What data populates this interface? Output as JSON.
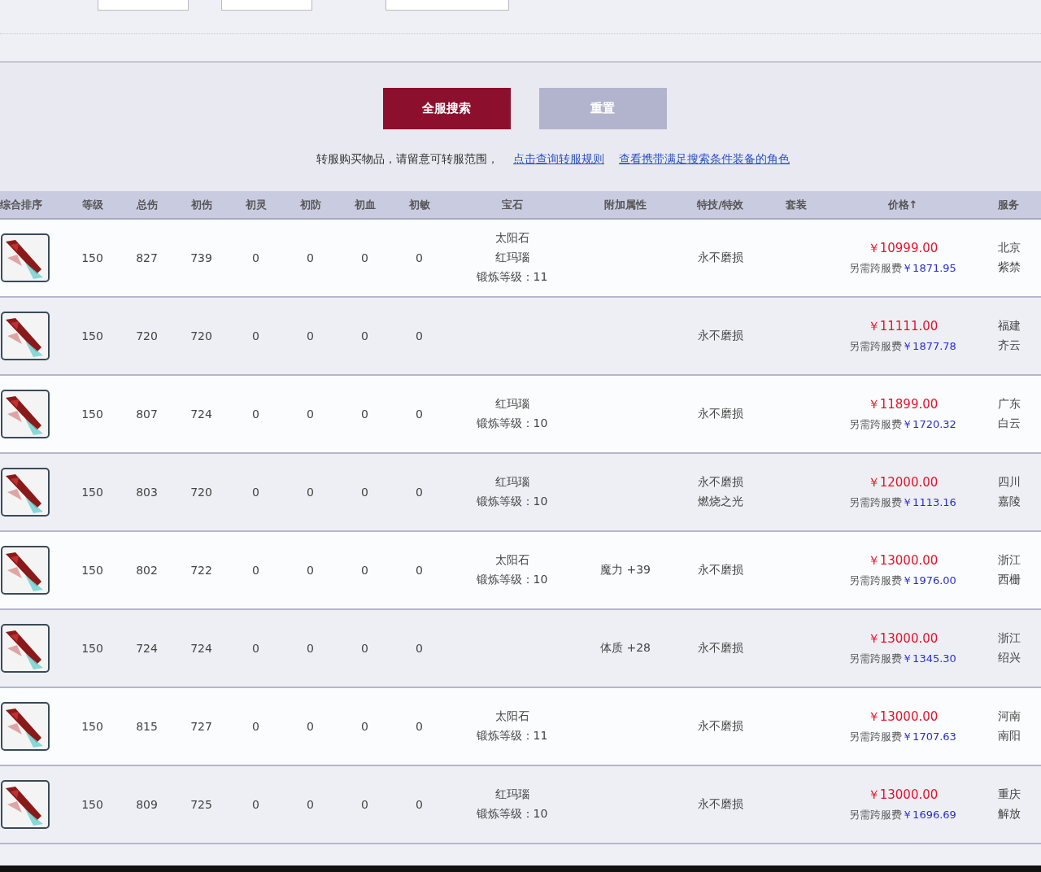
{
  "buttons": [
    {
      "label": "全服搜索",
      "kind": "primary"
    },
    {
      "label": "重置",
      "kind": "secondary"
    }
  ],
  "notice": {
    "text": "转服购买物品，请留意可转服范围，",
    "links": [
      "点击查询转服规则",
      "查看携带满足搜索条件装备的角色"
    ]
  },
  "table": {
    "columns": [
      "综合排序",
      "等级",
      "总伤",
      "初伤",
      "初灵",
      "初防",
      "初血",
      "初敏",
      "宝石",
      "附加属性",
      "特技/特效",
      "套装",
      "价格↑",
      "服务"
    ],
    "rows": [
      {
        "level": "150",
        "total": "827",
        "base": [
          "739",
          "0",
          "0",
          "0",
          "0"
        ],
        "gems": [
          "太阳石",
          "红玛瑙",
          "锻炼等级：11"
        ],
        "attrs": [],
        "skills": [
          "永不磨损"
        ],
        "price": "￥10999.00",
        "fee_label": "另需跨服费",
        "fee": "￥1871.95",
        "server": [
          "北京",
          "紫禁"
        ]
      },
      {
        "level": "150",
        "total": "720",
        "base": [
          "720",
          "0",
          "0",
          "0",
          "0"
        ],
        "gems": [],
        "attrs": [],
        "skills": [
          "永不磨损"
        ],
        "price": "￥11111.00",
        "fee_label": "另需跨服费",
        "fee": "￥1877.78",
        "server": [
          "福建",
          "齐云"
        ]
      },
      {
        "level": "150",
        "total": "807",
        "base": [
          "724",
          "0",
          "0",
          "0",
          "0"
        ],
        "gems": [
          "红玛瑙",
          "锻炼等级：10"
        ],
        "attrs": [],
        "skills": [
          "永不磨损"
        ],
        "price": "￥11899.00",
        "fee_label": "另需跨服费",
        "fee": "￥1720.32",
        "server": [
          "广东",
          "白云"
        ]
      },
      {
        "level": "150",
        "total": "803",
        "base": [
          "720",
          "0",
          "0",
          "0",
          "0"
        ],
        "gems": [
          "红玛瑙",
          "锻炼等级：10"
        ],
        "attrs": [],
        "skills": [
          "永不磨损",
          "燃烧之光"
        ],
        "price": "￥12000.00",
        "fee_label": "另需跨服费",
        "fee": "￥1113.16",
        "server": [
          "四川",
          "嘉陵"
        ]
      },
      {
        "level": "150",
        "total": "802",
        "base": [
          "722",
          "0",
          "0",
          "0",
          "0"
        ],
        "gems": [
          "太阳石",
          "锻炼等级：10"
        ],
        "attrs": [
          "魔力 +39"
        ],
        "skills": [
          "永不磨损"
        ],
        "price": "￥13000.00",
        "fee_label": "另需跨服费",
        "fee": "￥1976.00",
        "server": [
          "浙江",
          "西栅"
        ]
      },
      {
        "level": "150",
        "total": "724",
        "base": [
          "724",
          "0",
          "0",
          "0",
          "0"
        ],
        "gems": [],
        "attrs": [
          "体质 +28"
        ],
        "skills": [
          "永不磨损"
        ],
        "price": "￥13000.00",
        "fee_label": "另需跨服费",
        "fee": "￥1345.30",
        "server": [
          "浙江",
          "绍兴"
        ]
      },
      {
        "level": "150",
        "total": "815",
        "base": [
          "727",
          "0",
          "0",
          "0",
          "0"
        ],
        "gems": [
          "太阳石",
          "锻炼等级：11"
        ],
        "attrs": [],
        "skills": [
          "永不磨损"
        ],
        "price": "￥13000.00",
        "fee_label": "另需跨服费",
        "fee": "￥1707.63",
        "server": [
          "河南",
          "南阳"
        ]
      },
      {
        "level": "150",
        "total": "809",
        "base": [
          "725",
          "0",
          "0",
          "0",
          "0"
        ],
        "gems": [
          "红玛瑙",
          "锻炼等级：10"
        ],
        "attrs": [],
        "skills": [
          "永不磨损"
        ],
        "price": "￥13000.00",
        "fee_label": "另需跨服费",
        "fee": "￥1696.69",
        "server": [
          "重庆",
          "解放"
        ]
      }
    ]
  }
}
